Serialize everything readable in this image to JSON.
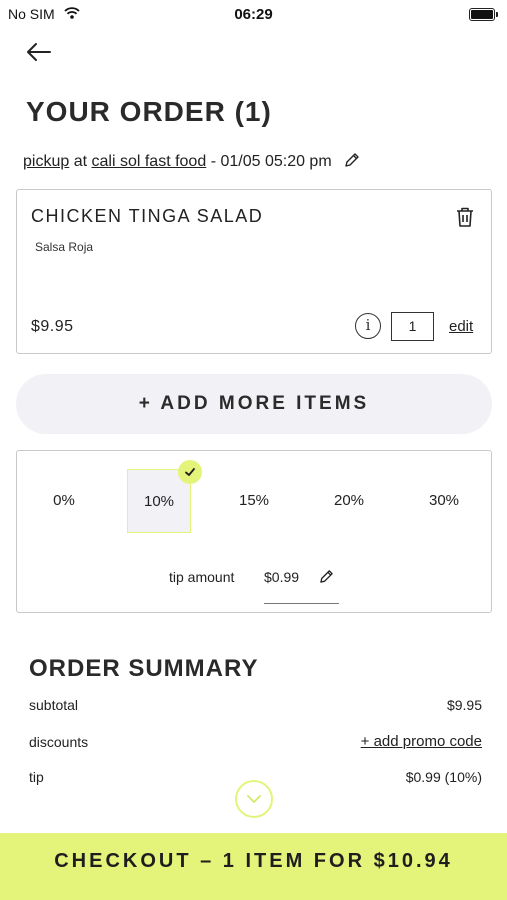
{
  "status_bar": {
    "carrier": "No SIM",
    "time": "06:29"
  },
  "order": {
    "title": "YOUR ORDER (1)",
    "mode": "pickup",
    "at": "at",
    "restaurant": "cali sol fast food",
    "datetime": "- 01/05 05:20 pm"
  },
  "item": {
    "name": "CHICKEN TINGA SALAD",
    "modifier": "Salsa Roja",
    "price": "$9.95",
    "info_glyph": "i",
    "quantity": "1",
    "edit_label": "edit"
  },
  "add_more_label": "+ ADD MORE ITEMS",
  "tip": {
    "options": [
      "0%",
      "10%",
      "15%",
      "20%",
      "30%"
    ],
    "selected": "10%",
    "amount_label": "tip amount",
    "amount": "$0.99"
  },
  "summary": {
    "title": "ORDER SUMMARY",
    "subtotal_label": "subtotal",
    "subtotal": "$9.95",
    "discounts_label": "discounts",
    "promo_label": "+ add promo code",
    "tip_label": "tip",
    "tip_value": "$0.99 (10%)"
  },
  "checkout_label": "CHECKOUT – 1 ITEM FOR $10.94",
  "colors": {
    "accent": "#e4f47a",
    "pill_bg": "#f2f2f6",
    "border": "#c9c9cc"
  },
  "icons": [
    "wifi-icon",
    "battery-icon",
    "back-arrow-icon",
    "pencil-icon",
    "trash-icon",
    "info-icon",
    "check-icon",
    "chevron-down-icon"
  ]
}
